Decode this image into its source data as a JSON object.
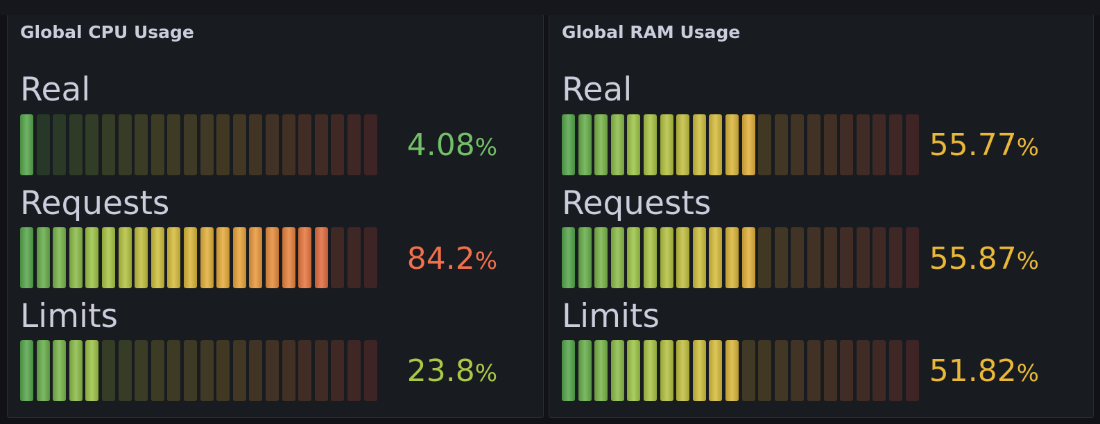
{
  "panels": [
    {
      "title": "Global CPU Usage",
      "gauges": [
        {
          "label": "Real",
          "value": "4.08",
          "unit": "%",
          "percent": 4.08,
          "color": "#73bf69"
        },
        {
          "label": "Requests",
          "value": "84.2",
          "unit": "%",
          "percent": 84.2,
          "color": "#f2704c"
        },
        {
          "label": "Limits",
          "value": "23.8",
          "unit": "%",
          "percent": 23.8,
          "color": "#a9c848"
        }
      ]
    },
    {
      "title": "Global RAM Usage",
      "gauges": [
        {
          "label": "Real",
          "value": "55.77",
          "unit": "%",
          "percent": 55.77,
          "color": "#eab839"
        },
        {
          "label": "Requests",
          "value": "55.87",
          "unit": "%",
          "percent": 55.87,
          "color": "#eab839"
        },
        {
          "label": "Limits",
          "value": "51.82",
          "unit": "%",
          "percent": 51.82,
          "color": "#eab839"
        }
      ]
    }
  ],
  "gauge_style": {
    "segment_count": 22,
    "gradient_stops": [
      "#56a64b",
      "#9fc547",
      "#d3be3c",
      "#e9a83a",
      "#e8793f",
      "#d44a3a"
    ]
  }
}
